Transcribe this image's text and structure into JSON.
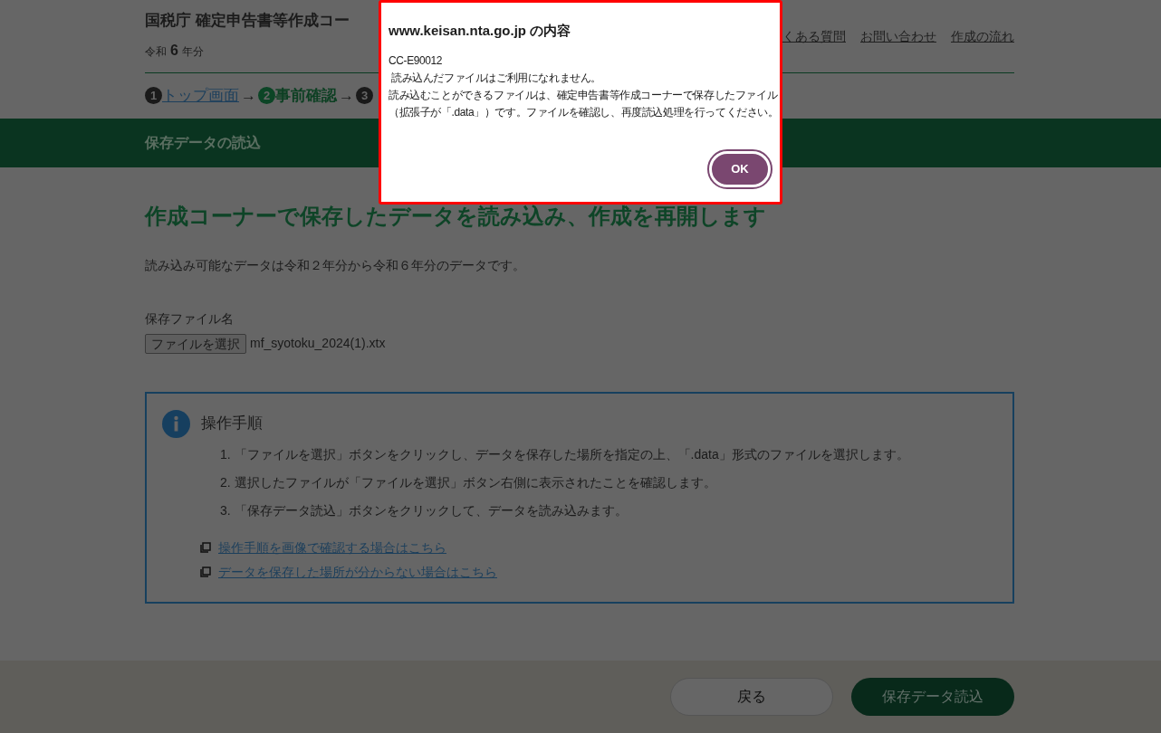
{
  "header": {
    "title": "国税庁 確定申告書等作成コー",
    "year_prefix": "令和",
    "year": "6",
    "year_suffix": "年分",
    "links": [
      "くある質問",
      "お問い合わせ",
      "作成の流れ"
    ]
  },
  "breadcrumb": {
    "separator": "→",
    "steps": [
      {
        "number": "1",
        "label": "トップ画面",
        "selected": false
      },
      {
        "number": "2",
        "label": "事前確認",
        "selected": true
      },
      {
        "number": "3",
        "selected": false
      }
    ]
  },
  "band": {
    "title": "保存データの読込"
  },
  "heading": "作成コーナーで保存したデータを読み込み、作成を再開します",
  "note": "読み込み可能なデータは令和２年分から令和６年分のデータです。",
  "file": {
    "label": "保存ファイル名",
    "button": "ファイルを選択",
    "value": "mf_syotoku_2024(1).xtx"
  },
  "info": {
    "title": "操作手順",
    "steps": [
      {
        "number": "1.",
        "text": "「ファイルを選択」ボタンをクリックし、データを保存した場所を指定の上、「.data」形式のファイルを選択します。"
      },
      {
        "number": "2.",
        "text": "選択したファイルが「ファイルを選択」ボタン右側に表示されたことを確認します。"
      },
      {
        "number": "3.",
        "text": "「保存データ読込」ボタンをクリックして、データを読み込みます。"
      }
    ],
    "links": [
      "操作手順を画像で確認する場合はこちら",
      "データを保存した場所が分からない場合はこちら"
    ]
  },
  "footer": {
    "buttons": [
      {
        "label": "戻る",
        "kind": "secondary"
      },
      {
        "label": "保存データ読込",
        "kind": "primary"
      }
    ]
  },
  "dialog": {
    "title": "www.keisan.nta.go.jp の内容",
    "lines": [
      "CC-E90012",
      " 読み込んだファイルはご利用になれません。",
      "読み込むことができるファイルは、確定申告書等作成コーナーで保存したファイル",
      "（拡張子が「.data」）です。ファイルを確認し、再度読込処理を行ってください。"
    ],
    "ok": "OK"
  }
}
